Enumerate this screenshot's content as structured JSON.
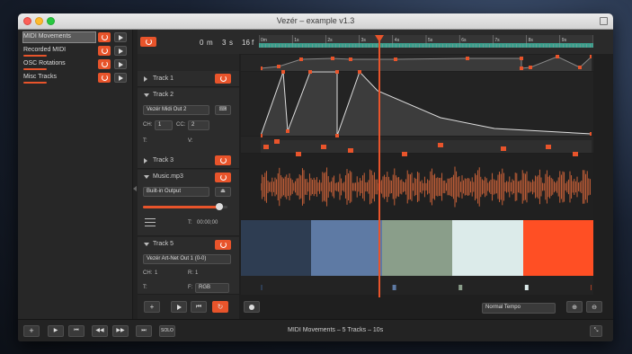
{
  "window": {
    "title": "Vezér – example v1.3"
  },
  "compositions": [
    {
      "label": "MIDI Movements"
    },
    {
      "label": "Recorded MIDI"
    },
    {
      "label": "OSC Rotations"
    },
    {
      "label": "Misc Tracks"
    }
  ],
  "timecode": {
    "minutes": "0",
    "min_unit": "m",
    "seconds": "3",
    "sec_unit": "s",
    "frames": "16",
    "frame_unit": "f"
  },
  "ruler_ticks": [
    "0m",
    "1s",
    "2s",
    "3s",
    "4s",
    "5s",
    "6s",
    "7s",
    "8s",
    "9s"
  ],
  "tracks": {
    "track1": {
      "name": "Track 1"
    },
    "track2": {
      "name": "Track 2",
      "output": "Vezér Midi Out 2",
      "ch_label": "CH:",
      "ch_value": "1",
      "cc_label": "CC:",
      "cc_value": "2",
      "t_label": "T:",
      "v_label": "V:"
    },
    "track3": {
      "name": "Track 3"
    },
    "music": {
      "name": "Music.mp3",
      "output": "Built-in Output",
      "t_label": "T:",
      "t_value": "00:00;00",
      "volume": 0.9
    },
    "track5": {
      "name": "Track 5",
      "output": "Vezér Art-Net Out 1 (0-0)",
      "ch_label": "CH:",
      "ch_value": "1",
      "r_label": "R:",
      "r_value": "1",
      "t_label": "T:",
      "f_label": "F:",
      "f_value": "RGB"
    }
  },
  "color_blocks": [
    "#2e3d52",
    "#5e7aa4",
    "#8a9e8a",
    "#dcebea",
    "#ff4f24"
  ],
  "tempo": {
    "value": "Normal Tempo"
  },
  "statusbar": {
    "text": "MIDI Movements – 5 Tracks – 10s",
    "solo_label": "SOLO"
  },
  "playhead": {
    "seconds": 3.55
  },
  "colors": {
    "accent": "#e8542b",
    "teal": "#3a9e8c"
  },
  "icons": [
    "power-icon",
    "play-icon",
    "rewind-icon",
    "loop-icon",
    "record-icon",
    "zoom-in-icon",
    "zoom-out-icon",
    "add-icon",
    "prev-icon",
    "next-icon",
    "forward-icon",
    "list-icon",
    "eject-icon",
    "keyboard-icon"
  ]
}
